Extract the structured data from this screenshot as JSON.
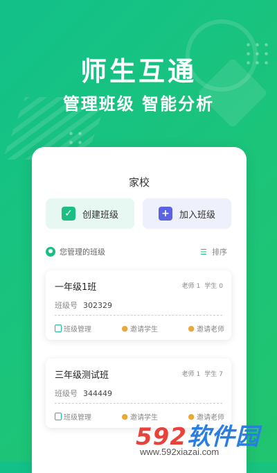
{
  "hero": {
    "title": "师生互通",
    "subtitle": "管理班级 智能分析"
  },
  "card": {
    "title": "家校",
    "create_label": "创建班级",
    "join_label": "加入班级"
  },
  "section": {
    "label": "您管理的班级",
    "sort_label": "排序"
  },
  "classes": [
    {
      "name": "一年级1班",
      "teacher_label": "老师",
      "teacher_count": "1",
      "student_label": "学生",
      "student_count": "0",
      "code_label": "班级号",
      "code": "302329",
      "actions": [
        "班级管理",
        "邀请学生",
        "邀请老师"
      ]
    },
    {
      "name": "三年级测试班",
      "teacher_label": "老师",
      "teacher_count": "1",
      "student_label": "学生",
      "student_count": "7",
      "code_label": "班级号",
      "code": "344449",
      "actions": [
        "班级管理",
        "邀请学生",
        "邀请老师"
      ]
    }
  ],
  "watermark": {
    "number": "592",
    "text": "软件园",
    "url": "www.592xiazai.com"
  },
  "colors": {
    "brand_green": "#1bbf84",
    "join_purple": "#5b63e0",
    "invite_orange": "#e8a93a"
  }
}
